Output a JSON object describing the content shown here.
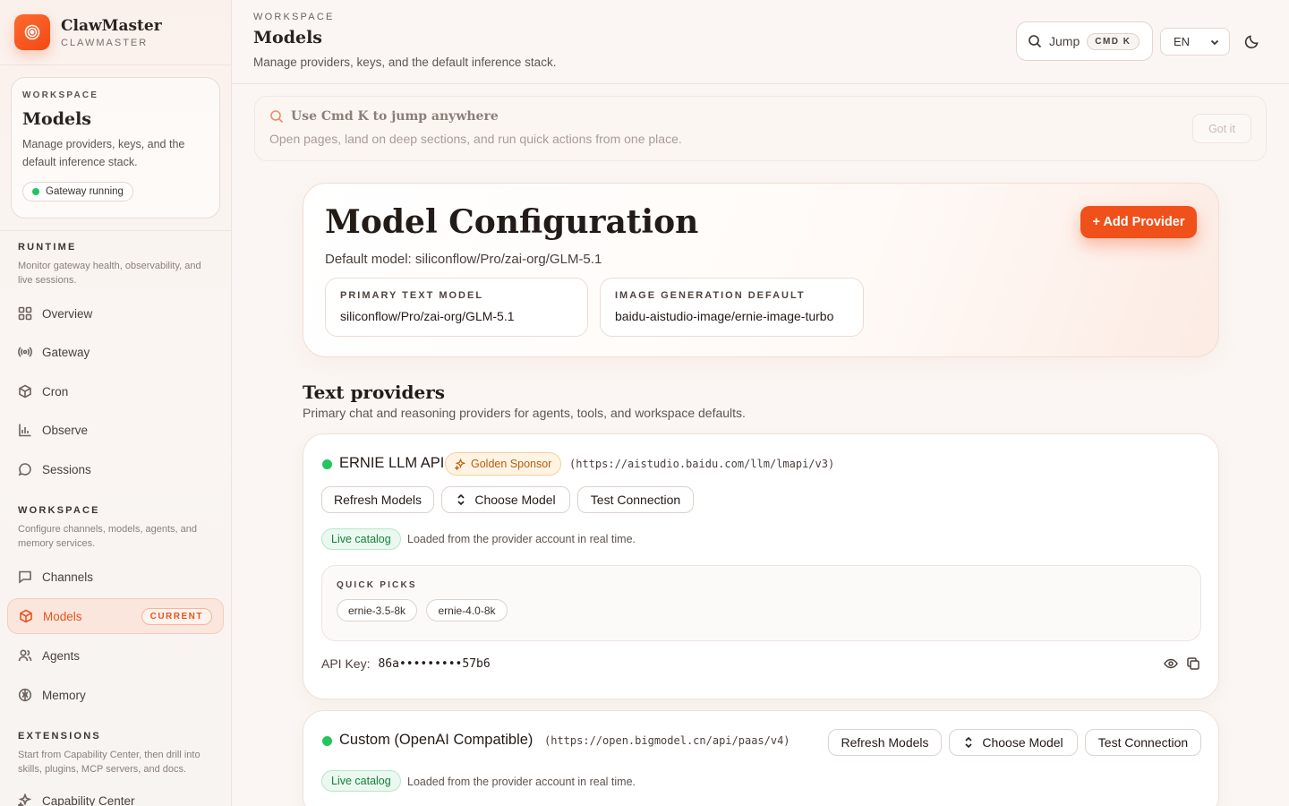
{
  "brand": {
    "name": "ClawMaster",
    "sub": "CLAWMASTER"
  },
  "sidebar": {
    "workspace_card": {
      "eyebrow": "WORKSPACE",
      "title": "Models",
      "desc": "Manage providers, keys, and the default inference stack.",
      "status": "Gateway running"
    },
    "runtime": {
      "label": "RUNTIME",
      "desc": "Monitor gateway health, observability, and live sessions.",
      "items": [
        "Overview",
        "Gateway",
        "Cron",
        "Observe",
        "Sessions"
      ]
    },
    "workspace": {
      "label": "WORKSPACE",
      "desc": "Configure channels, models, agents, and memory services.",
      "items": [
        "Channels",
        "Models",
        "Agents",
        "Memory"
      ],
      "current_badge": "CURRENT"
    },
    "extensions": {
      "label": "EXTENSIONS",
      "desc": "Start from Capability Center, then drill into skills, plugins, MCP servers, and docs.",
      "items": [
        "Capability Center"
      ]
    }
  },
  "header": {
    "eyebrow": "WORKSPACE",
    "title": "Models",
    "desc": "Manage providers, keys, and the default inference stack.",
    "jump_label": "Jump",
    "jump_kbd": "CMD K",
    "lang": "EN"
  },
  "tip": {
    "title": "Use Cmd K to jump anywhere",
    "desc": "Open pages, land on deep sections, and run quick actions from one place.",
    "dismiss": "Got it"
  },
  "config": {
    "title": "Model Configuration",
    "default_model": "Default model: siliconflow/Pro/zai-org/GLM-5.1",
    "add_button": "+ Add Provider",
    "primary_label": "PRIMARY TEXT MODEL",
    "primary_value": "siliconflow/Pro/zai-org/GLM-5.1",
    "image_label": "IMAGE GENERATION DEFAULT",
    "image_value": "baidu-aistudio-image/ernie-image-turbo"
  },
  "text_providers": {
    "title": "Text providers",
    "desc": "Primary chat and reasoning providers for agents, tools, and workspace defaults."
  },
  "providers": [
    {
      "name": "ERNIE LLM API",
      "sponsor": "Golden Sponsor",
      "url": "(https://aistudio.baidu.com/llm/lmapi/v3)",
      "refresh": "Refresh Models",
      "choose": "Choose Model",
      "test": "Test Connection",
      "live": "Live catalog",
      "live_desc": "Loaded from the provider account in real time.",
      "quick_label": "QUICK PICKS",
      "quick_picks": [
        "ernie-3.5-8k",
        "ernie-4.0-8k"
      ],
      "api_key_label": "API Key:",
      "api_key": "86a•••••••••57b6"
    },
    {
      "name": "Custom (OpenAI Compatible)",
      "url": "(https://open.bigmodel.cn/api/paas/v4)",
      "refresh": "Refresh Models",
      "choose": "Choose Model",
      "test": "Test Connection",
      "live": "Live catalog",
      "live_desc": "Loaded from the provider account in real time."
    }
  ],
  "colors": {
    "accent": "#f0501a",
    "status_green": "#22c55e"
  }
}
